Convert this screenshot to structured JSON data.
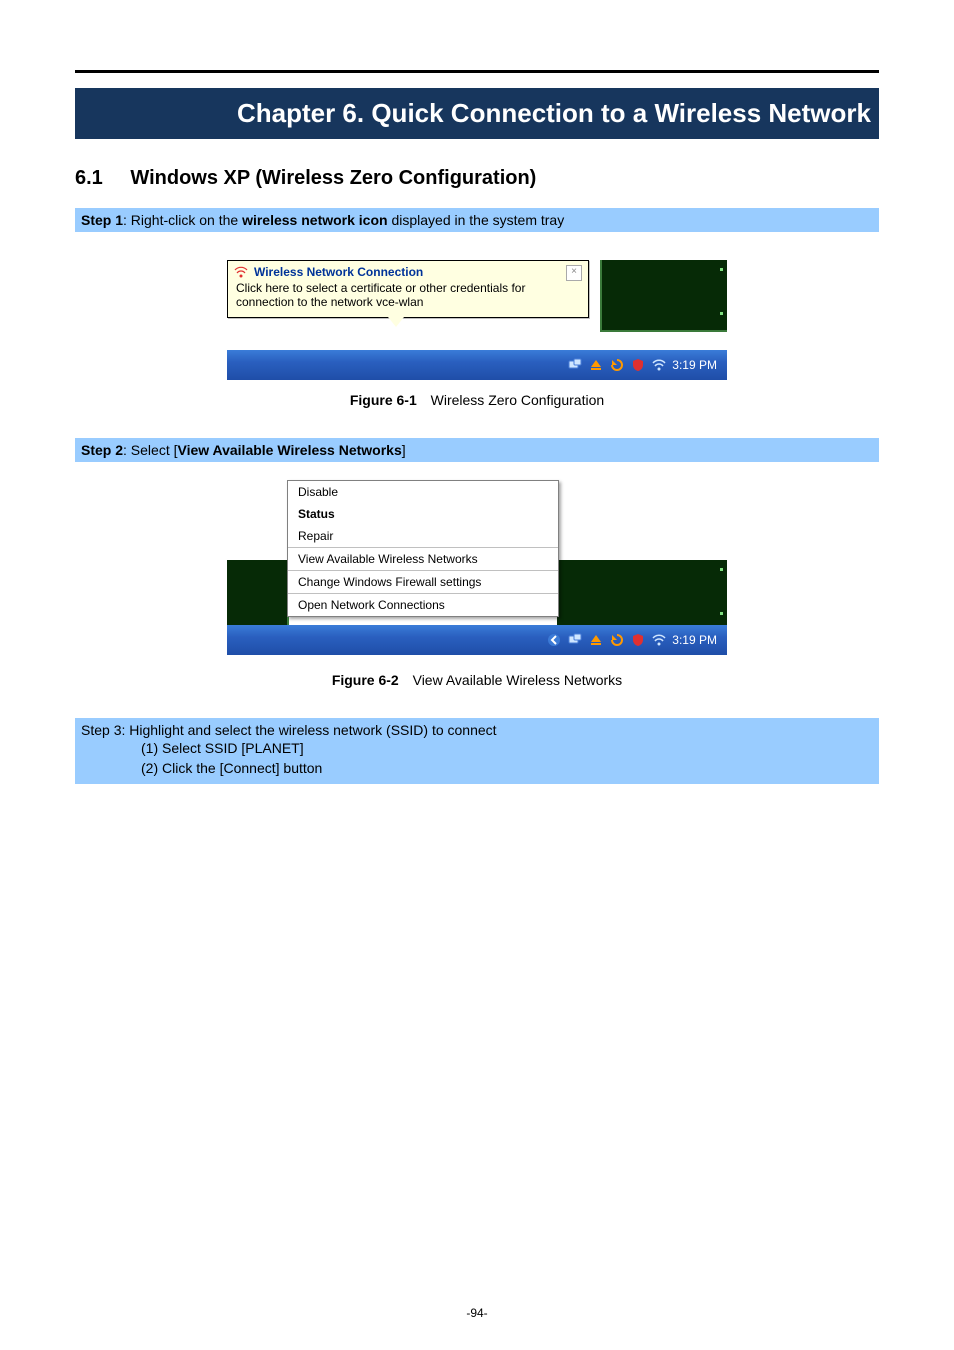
{
  "chapter_bar": "Chapter 6.   Quick Connection to a Wireless Network",
  "section": {
    "num": "6.1",
    "title": "Windows XP (Wireless Zero Configuration)"
  },
  "step1": {
    "prefix": "Step 1",
    "text_before": ": Right-click on the ",
    "bold1": "wireless network icon",
    "text_after": " displayed in the system tray"
  },
  "fig1": {
    "balloon_title": "Wireless Network Connection",
    "balloon_body": "Click here to select a certificate or other credentials for connection to the network vce-wlan",
    "close": "×",
    "time": "3:19 PM",
    "caption_bold": "Figure 6-1",
    "caption_text": "Wireless Zero Configuration"
  },
  "step2": {
    "prefix": "Step 2",
    "text_before": ": Select [",
    "bold1": "View Available Wireless Networks",
    "text_after": "]"
  },
  "fig2": {
    "menu": {
      "grp1": [
        "Disable",
        "Status",
        "Repair"
      ],
      "grp2": [
        "View Available Wireless Networks"
      ],
      "grp3": [
        "Change Windows Firewall settings"
      ],
      "grp4": [
        "Open Network Connections"
      ]
    },
    "time": "3:19 PM",
    "caption_bold": "Figure 6-2",
    "caption_text": "View Available Wireless Networks"
  },
  "step3": {
    "prefix": "Step 3",
    "text": ": Highlight and select the wireless network (SSID) to connect",
    "sub1": "(1)  Select SSID [PLANET]",
    "sub2_pre": "(2)  Click the [",
    "sub2_bold": "Connect",
    "sub2_post": "] button"
  },
  "page_number": "-94-"
}
